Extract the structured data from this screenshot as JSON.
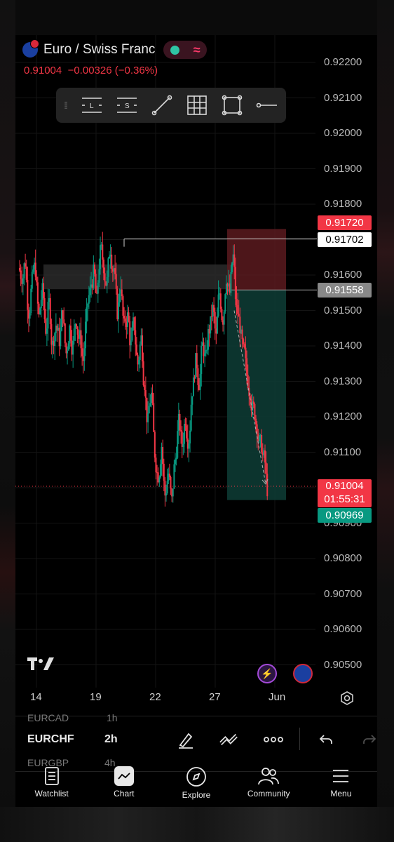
{
  "header": {
    "symbol_name": "Euro / Swiss Franc",
    "last_price": "0.91004",
    "change": "−0.00326",
    "change_pct": "(−0.36%)"
  },
  "drawing_tools": [
    {
      "name": "long-position-tool",
      "glyph": "L"
    },
    {
      "name": "short-position-tool",
      "glyph": "S"
    },
    {
      "name": "trend-line-tool"
    },
    {
      "name": "grid-tool"
    },
    {
      "name": "rectangle-tool"
    },
    {
      "name": "horizontal-ray-tool"
    }
  ],
  "price_axis": [
    "0.92200",
    "0.92100",
    "0.92000",
    "0.91900",
    "0.91800",
    "0.91700",
    "0.91600",
    "0.91500",
    "0.91400",
    "0.91300",
    "0.91200",
    "0.91100",
    "0.91000",
    "0.90900",
    "0.90800",
    "0.90700",
    "0.90600",
    "0.90500"
  ],
  "price_tags": {
    "stop": "0.91720",
    "high_line": "0.91702",
    "entry": "0.91558",
    "current": "0.91004",
    "countdown": "01:55:31",
    "target": "0.90969"
  },
  "time_axis": [
    "14",
    "19",
    "22",
    "27",
    "Jun"
  ],
  "colors": {
    "up": "#089981",
    "down": "#f23645",
    "background": "#000000",
    "loss_zone": "#5a1a1f",
    "profit_zone": "#0d3a33"
  },
  "chart_data": {
    "type": "candlestick",
    "symbol": "EURCHF",
    "timeframe": "2h",
    "ylim": [
      0.9045,
      0.9225
    ],
    "yticks": [
      0.922,
      0.921,
      0.92,
      0.919,
      0.918,
      0.917,
      0.916,
      0.915,
      0.914,
      0.913,
      0.912,
      0.911,
      0.91,
      0.909,
      0.908,
      0.907,
      0.906,
      0.905
    ],
    "xticks": [
      "14",
      "19",
      "22",
      "27",
      "Jun"
    ],
    "close_path": [
      0.916,
      0.9164,
      0.915,
      0.9158,
      0.9162,
      0.9148,
      0.9155,
      0.9145,
      0.9152,
      0.914,
      0.9146,
      0.9142,
      0.915,
      0.9138,
      0.9145,
      0.914,
      0.9148,
      0.9142,
      0.9136,
      0.9148,
      0.9155,
      0.916,
      0.9152,
      0.9166,
      0.9163,
      0.9158,
      0.9168,
      0.9162,
      0.915,
      0.9158,
      0.9145,
      0.9148,
      0.914,
      0.9146,
      0.9135,
      0.9142,
      0.913,
      0.9118,
      0.9126,
      0.911,
      0.9104,
      0.9112,
      0.9098,
      0.9104,
      0.9096,
      0.9108,
      0.9118,
      0.9112,
      0.912,
      0.9114,
      0.9128,
      0.9135,
      0.913,
      0.914,
      0.9136,
      0.9145,
      0.915,
      0.9142,
      0.9155,
      0.9148,
      0.916,
      0.9155,
      0.9165,
      0.915,
      0.9146,
      0.9138,
      0.9132,
      0.9128,
      0.9122,
      0.9118,
      0.9112,
      0.9108,
      0.91
    ],
    "resistance_zone": [
      0.9156,
      0.9163
    ],
    "long_short_position": {
      "stop": 0.9172,
      "entry": 0.91558,
      "target": 0.90969
    },
    "current_price": 0.91004
  },
  "sub_bar": {
    "ghost_above": "EURCAD",
    "ghost_above_tf": "1h",
    "symbol": "EURCHF",
    "timeframe": "2h",
    "ghost_below": "EURGBP",
    "ghost_below_tf": "4h"
  },
  "nav": [
    {
      "label": "Watchlist",
      "icon": "watchlist-icon"
    },
    {
      "label": "Chart",
      "icon": "chart-icon"
    },
    {
      "label": "Explore",
      "icon": "compass-icon"
    },
    {
      "label": "Community",
      "icon": "community-icon"
    },
    {
      "label": "Menu",
      "icon": "menu-icon"
    }
  ]
}
